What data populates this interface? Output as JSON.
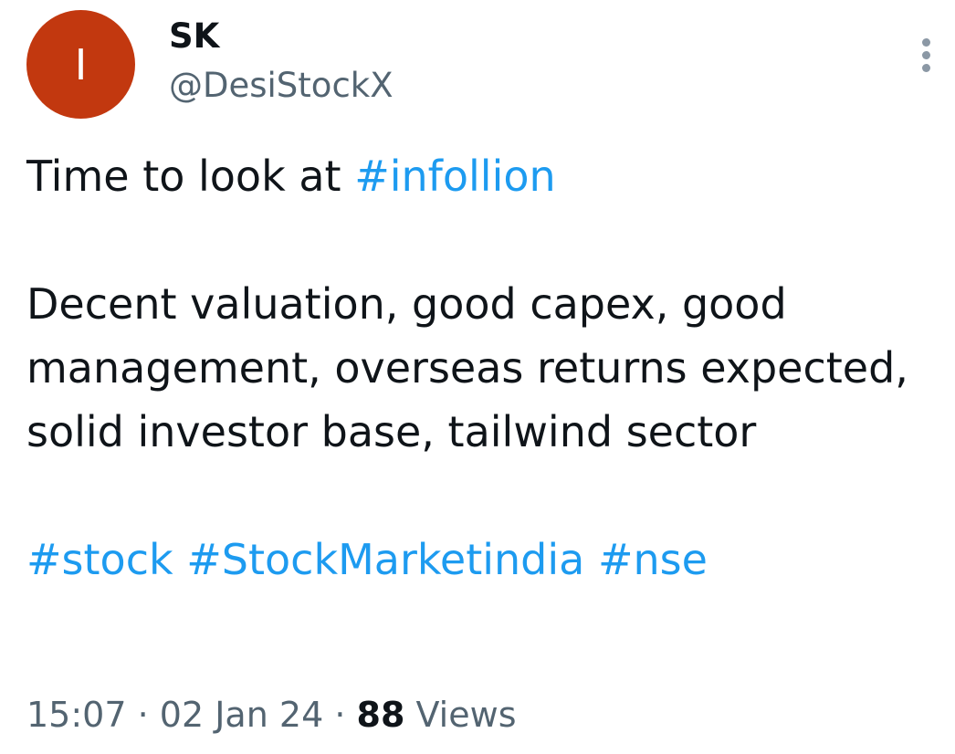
{
  "author": {
    "avatar_letter": "I",
    "avatar_color": "#c2380f",
    "display_name": "SK",
    "handle": "@DesiStockX"
  },
  "tweet": {
    "line1_text": "Time to look at ",
    "line1_hashtag": "#infollion",
    "paragraph2": "Decent valuation, good capex, good management, overseas returns expected, solid investor base, tailwind sector",
    "hashtags": [
      "#stock",
      "#StockMarketindia",
      "#nse"
    ]
  },
  "meta": {
    "time": "15:07",
    "separator": "·",
    "date": "02 Jan 24",
    "views_count": "88",
    "views_label": "Views"
  },
  "colors": {
    "link": "#1d9bf0",
    "text": "#0f1419",
    "secondary": "#536471"
  },
  "icons": {
    "more": "more-vertical-icon"
  }
}
